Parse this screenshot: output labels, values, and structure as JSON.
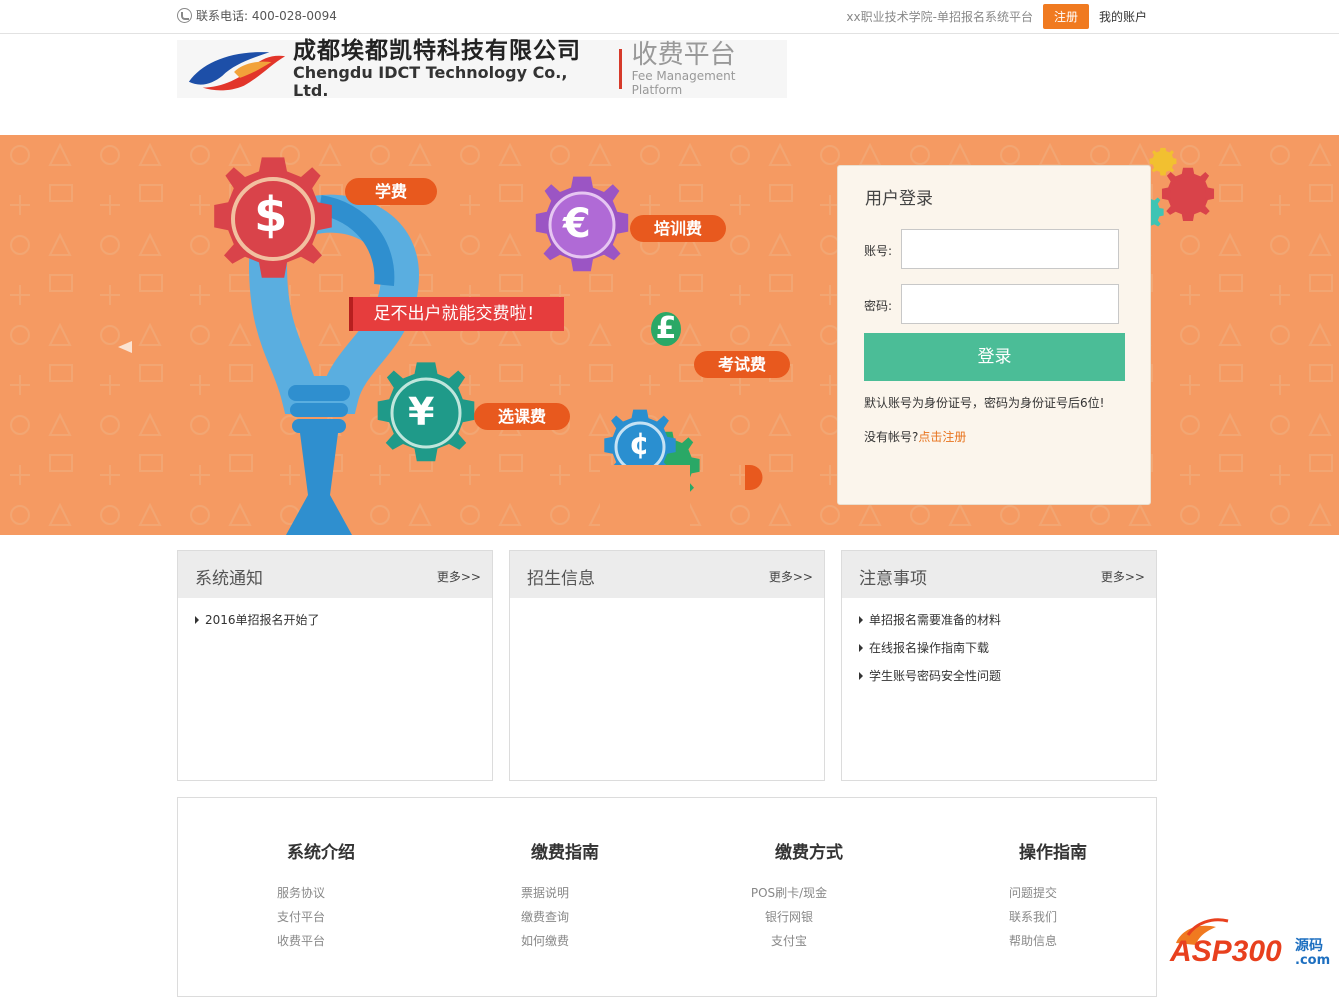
{
  "topbar": {
    "phone": "联系电话: 400-028-0094",
    "platform": "xx职业技术学院-单招报名系统平台",
    "register": "注册",
    "account": "我的账户"
  },
  "header": {
    "company_cn": "成都埃都凯特科技有限公司",
    "company_en": "Chengdu IDCT Technology Co., Ltd.",
    "platform_cn": "收费平台",
    "platform_en": "Fee Management Platform"
  },
  "banner": {
    "tags": [
      "学费",
      "培训费",
      "考试费",
      "选课费"
    ],
    "slogan": "足不出户就能交费啦！",
    "symbols": [
      "$",
      "€",
      "£",
      "¥",
      "¢"
    ]
  },
  "login": {
    "title": "用户登录",
    "account_label": "账号:",
    "password_label": "密码:",
    "account_value": "",
    "password_value": "",
    "submit": "登录",
    "note": "默认账号为身份证号，密码为身份证号后6位!",
    "no_account": "没有帐号?",
    "register_link": "点击注册"
  },
  "panels": [
    {
      "title": "系统通知",
      "more": "更多>>",
      "items": [
        "2016单招报名开始了"
      ]
    },
    {
      "title": "招生信息",
      "more": "更多>>",
      "items": []
    },
    {
      "title": "注意事项",
      "more": "更多>>",
      "items": [
        "单招报名需要准备的材料",
        "在线报名操作指南下载",
        "学生账号密码安全性问题"
      ]
    }
  ],
  "footer": [
    {
      "title": "系统介绍",
      "links": [
        "服务协议",
        "支付平台",
        "收费平台"
      ]
    },
    {
      "title": "缴费指南",
      "links": [
        "票据说明",
        "缴费查询",
        "如何缴费"
      ]
    },
    {
      "title": "缴费方式",
      "links": [
        "POS刷卡/现金",
        "银行网银",
        "支付宝"
      ]
    },
    {
      "title": "操作指南",
      "links": [
        "问题提交",
        "联系我们",
        "帮助信息"
      ]
    }
  ],
  "watermark": {
    "text": "ASP300",
    "sub": "源码",
    "domain": ".com"
  },
  "colors": {
    "accent": "#f07a20",
    "banner": "#f59a62",
    "login_button": "#4bbd97",
    "gear_red": "#d9434a",
    "gear_purple": "#9b55c4",
    "gear_green": "#2aa866",
    "gear_teal": "#1f9a89",
    "gear_blue": "#2a8fd0"
  }
}
